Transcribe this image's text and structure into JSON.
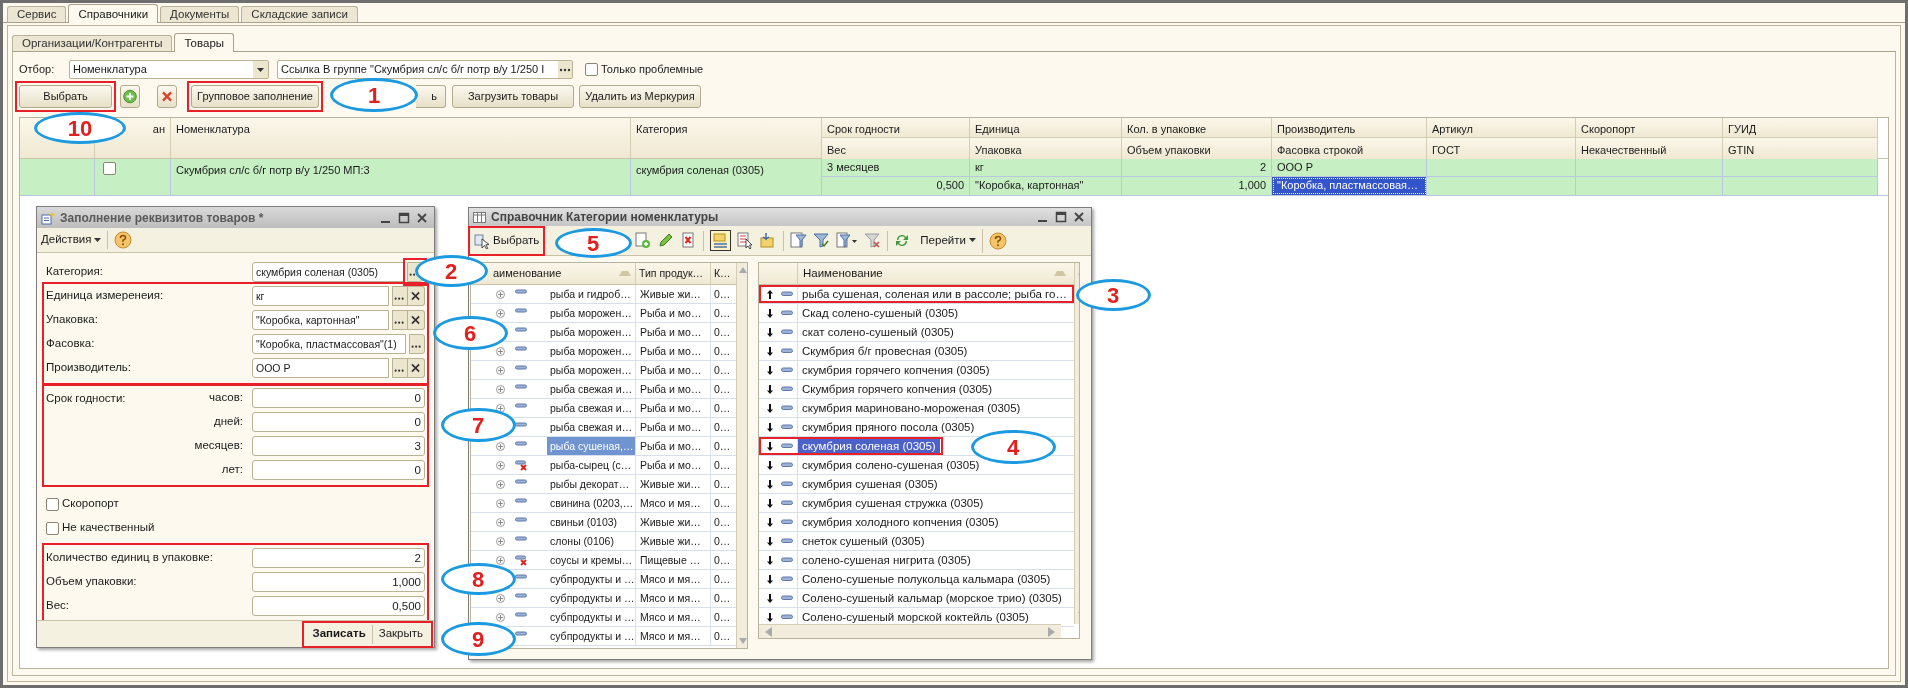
{
  "top_tabs": [
    {
      "label": "Сервис",
      "selected": false
    },
    {
      "label": "Справочники",
      "selected": true
    },
    {
      "label": "Документы",
      "selected": false
    },
    {
      "label": "Складские записи",
      "selected": false
    }
  ],
  "sub_tabs": [
    {
      "label": "Организации/Контрагенты",
      "selected": false
    },
    {
      "label": "Товары",
      "selected": true
    }
  ],
  "filter": {
    "label": "Отбор:",
    "field": "Номенклатура",
    "value": "Ссылка В группе \"Скумбрия сл/с б/г потр в/у 1/250 I",
    "checkbox": {
      "label": "Только проблемные",
      "checked": false
    }
  },
  "toolbar": [
    {
      "kind": "text",
      "label": "Выбрать"
    },
    {
      "kind": "add"
    },
    {
      "kind": "delete"
    },
    {
      "kind": "text",
      "label": "Групповое заполнение"
    },
    {
      "kind": "text",
      "label": "ь"
    },
    {
      "kind": "text",
      "label": "Загрузить товары"
    },
    {
      "kind": "text",
      "label": "Удалить из Меркурия"
    }
  ],
  "table": {
    "columns": [
      {
        "kind": "marker"
      },
      {
        "kind": "single",
        "label": "ан"
      },
      {
        "kind": "single",
        "label": "Номенклатура"
      },
      {
        "kind": "single",
        "label": "Категория"
      },
      {
        "kind": "double",
        "label": "Срок годности",
        "sublabel": "Вес"
      },
      {
        "kind": "double",
        "label": "Единица",
        "sublabel": "Упаковка"
      },
      {
        "kind": "double",
        "label": "Кол. в упаковке",
        "sublabel": "Объем упаковки"
      },
      {
        "kind": "double",
        "label": "Производитель",
        "sublabel": "Фасовка строкой"
      },
      {
        "kind": "double",
        "label": "Артикул",
        "sublabel": "ГОСТ"
      },
      {
        "kind": "double",
        "label": "Скоропорт",
        "sublabel": "Некачественный"
      },
      {
        "kind": "double",
        "label": "ГУИД",
        "sublabel": "GTIN"
      }
    ],
    "rows": [
      {
        "cells": [
          {
            "kind": "marker"
          },
          {
            "kind": "checkbox",
            "checked": false
          },
          {
            "kind": "single",
            "text": "Скумбрия сл/с б/г потр в/у 1/250 МП:3"
          },
          {
            "kind": "single",
            "text": "скумбрия соленая (0305)"
          },
          {
            "kind": "double",
            "lines": [
              {
                "text": "3 месяцев",
                "numeric": false,
                "selected": false
              },
              {
                "text": "0,500",
                "numeric": true,
                "selected": false
              }
            ]
          },
          {
            "kind": "double",
            "lines": [
              {
                "text": "кг",
                "numeric": false,
                "selected": false
              },
              {
                "text": "\"Коробка, картонная\"",
                "numeric": false,
                "selected": false
              }
            ]
          },
          {
            "kind": "double",
            "lines": [
              {
                "text": "2",
                "numeric": true,
                "selected": false
              },
              {
                "text": "1,000",
                "numeric": true,
                "selected": false
              }
            ]
          },
          {
            "kind": "double",
            "lines": [
              {
                "text": "ООО Р",
                "numeric": false,
                "selected": false
              },
              {
                "text": "\"Коробка, пластмассовая…",
                "numeric": false,
                "selected": true
              }
            ]
          },
          {
            "kind": "double"
          },
          {
            "kind": "double"
          },
          {
            "kind": "double"
          }
        ]
      }
    ]
  },
  "fill_dialog": {
    "title": "Заполнение реквизитов товаров *",
    "menu": "Действия",
    "fields": [
      {
        "label": "Категория:",
        "value": "скумбрия соленая (0305)",
        "clearable": false
      },
      {
        "label": "Единица измеренеия:",
        "value": "кг",
        "clearable": true
      },
      {
        "label": "Упаковка:",
        "value": "\"Коробка, картонная\"",
        "clearable": true
      },
      {
        "label": "Фасовка:",
        "value": "\"Коробка, пластмассовая\"(1)",
        "clearable": false
      },
      {
        "label": "Производитель:",
        "value": "ООО Р",
        "clearable": true
      }
    ],
    "shelf_life": {
      "label": "Срок годности:",
      "parts": [
        {
          "label": "часов:",
          "value": "0"
        },
        {
          "label": "дней:",
          "value": "0"
        },
        {
          "label": "месяцев:",
          "value": "3"
        },
        {
          "label": "лет:",
          "value": "0"
        }
      ]
    },
    "checkboxes": [
      {
        "label": "Скоропорт",
        "checked": false
      },
      {
        "label": "Не качественный",
        "checked": false
      }
    ],
    "numbers": [
      {
        "label": "Количество единиц в упаковке:",
        "value": "2"
      },
      {
        "label": "Объем упаковки:",
        "value": "1,000"
      },
      {
        "label": "Вес:",
        "value": "0,500"
      }
    ],
    "buttons": [
      {
        "label": "Записать",
        "default": true
      },
      {
        "label": "Закрыть",
        "default": false
      }
    ]
  },
  "catalog_dialog": {
    "title": "Справочник Категории номенклатуры",
    "select_button": "Выбрать",
    "goto_button": "Перейти",
    "groups": {
      "columns": [
        "аименование",
        "Тип продук…",
        "К…"
      ],
      "rows": [
        {
          "name": "рыба и гидроб…",
          "type": "Живые жи…",
          "code": "0…",
          "deleted": false,
          "selected": false
        },
        {
          "name": "рыба морожен…",
          "type": "Рыба и мо…",
          "code": "0…",
          "deleted": false,
          "selected": false
        },
        {
          "name": "рыба морожен…",
          "type": "Рыба и мо…",
          "code": "0…",
          "deleted": false,
          "selected": false
        },
        {
          "name": "рыба морожен…",
          "type": "Рыба и мо…",
          "code": "0…",
          "deleted": false,
          "selected": false
        },
        {
          "name": "рыба морожен…",
          "type": "Рыба и мо…",
          "code": "0…",
          "deleted": false,
          "selected": false
        },
        {
          "name": "рыба свежая и…",
          "type": "Рыба и мо…",
          "code": "0…",
          "deleted": false,
          "selected": false
        },
        {
          "name": "рыба свежая и…",
          "type": "Рыба и мо…",
          "code": "0…",
          "deleted": false,
          "selected": false
        },
        {
          "name": "рыба свежая и…",
          "type": "Рыба и мо…",
          "code": "0…",
          "deleted": false,
          "selected": false
        },
        {
          "name": "рыба сушеная,…",
          "type": "Рыба и мо…",
          "code": "0…",
          "deleted": false,
          "selected": true
        },
        {
          "name": "рыба-сырец (с…",
          "type": "Рыба и мо…",
          "code": "0…",
          "deleted": true,
          "selected": false
        },
        {
          "name": "рыбы декорат…",
          "type": "Живые жи…",
          "code": "0…",
          "deleted": false,
          "selected": false
        },
        {
          "name": "свинина (0203,…",
          "type": "Мясо и мя…",
          "code": "0…",
          "deleted": false,
          "selected": false
        },
        {
          "name": "свиньи (0103)",
          "type": "Живые жи…",
          "code": "0…",
          "deleted": false,
          "selected": false
        },
        {
          "name": "слоны (0106)",
          "type": "Живые жи…",
          "code": "0…",
          "deleted": false,
          "selected": false
        },
        {
          "name": "соусы и кремы…",
          "type": "Пищевые …",
          "code": "0…",
          "deleted": true,
          "selected": false
        },
        {
          "name": "субпродукты и …",
          "type": "Мясо и мя…",
          "code": "0…",
          "deleted": false,
          "selected": false
        },
        {
          "name": "субпродукты и …",
          "type": "Мясо и мя…",
          "code": "0…",
          "deleted": false,
          "selected": false
        },
        {
          "name": "субпродукты и …",
          "type": "Мясо и мя…",
          "code": "0…",
          "deleted": false,
          "selected": false
        },
        {
          "name": "субпродукты и …",
          "type": "Мясо и мя…",
          "code": "0…",
          "deleted": false,
          "selected": false
        }
      ]
    },
    "items": {
      "column": "Наименование",
      "rows": [
        {
          "kind": "parent",
          "name": "рыба сушеная, соленая или в рассоле; рыба го…",
          "selected": false
        },
        {
          "kind": "item",
          "name": "Скад солено-сушеный (0305)",
          "selected": false
        },
        {
          "kind": "item",
          "name": "скат солено-сушеный (0305)",
          "selected": false
        },
        {
          "kind": "item",
          "name": "Скумбрия б/г провесная (0305)",
          "selected": false
        },
        {
          "kind": "item",
          "name": "скумбрия горячего копчения (0305)",
          "selected": false
        },
        {
          "kind": "item",
          "name": "Скумбрия горячего копчения (0305)",
          "selected": false
        },
        {
          "kind": "item",
          "name": "скумбрия маринoвано-мороженая (0305)",
          "selected": false
        },
        {
          "kind": "item",
          "name": "скумбрия пряного посола (0305)",
          "selected": false
        },
        {
          "kind": "item",
          "name": "скумбрия соленая (0305)",
          "selected": true
        },
        {
          "kind": "item",
          "name": "скумбрия солено-сушеная (0305)",
          "selected": false
        },
        {
          "kind": "item",
          "name": "скумбрия сушеная (0305)",
          "selected": false
        },
        {
          "kind": "item",
          "name": "скумбрия сушеная стружка (0305)",
          "selected": false
        },
        {
          "kind": "item",
          "name": "скумбрия холодного копчения (0305)",
          "selected": false
        },
        {
          "kind": "item",
          "name": "снеток сушеный (0305)",
          "selected": false
        },
        {
          "kind": "item",
          "name": "солено-сушеная нигрита (0305)",
          "selected": false
        },
        {
          "kind": "item",
          "name": "Солено-сушеные полукольца кальмара (0305)",
          "selected": false
        },
        {
          "kind": "item",
          "name": "Солено-сушеный кальмар (морское трио) (0305)",
          "selected": false
        },
        {
          "kind": "item",
          "name": "Солено-сушеный морской коктейль (0305)",
          "selected": false
        }
      ]
    }
  },
  "callouts": [
    {
      "label": "1"
    },
    {
      "label": "10"
    },
    {
      "label": "2"
    },
    {
      "label": "5"
    },
    {
      "label": "3"
    },
    {
      "label": "6"
    },
    {
      "label": "7"
    },
    {
      "label": "4"
    },
    {
      "label": "8"
    },
    {
      "label": "9"
    }
  ]
}
